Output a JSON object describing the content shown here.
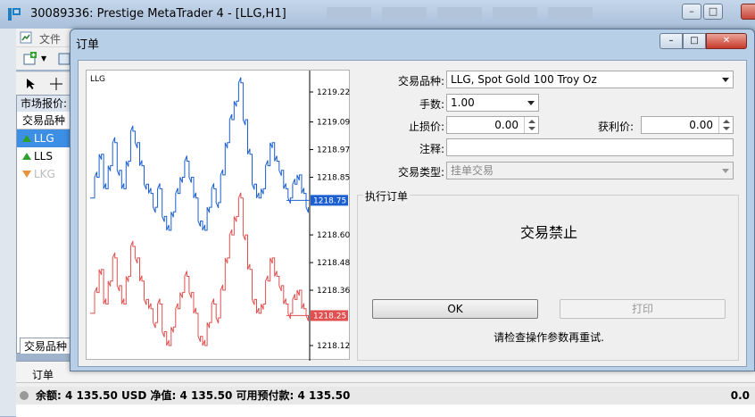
{
  "app": {
    "title": "30089336: Prestige MetaTrader 4 - [LLG,H1]",
    "menu_file": "文件"
  },
  "market_watch": {
    "title": "市场报价:",
    "column_header": "交易品种",
    "symbols": [
      {
        "name": "LLG",
        "direction": "up",
        "selected": true
      },
      {
        "name": "LLS",
        "direction": "up",
        "selected": false
      },
      {
        "name": "LKG",
        "direction": "down",
        "selected": false
      }
    ],
    "bottom_tab": "交易品种"
  },
  "terminal": {
    "tab": "订单",
    "balance_text": "余额: 4 135.50 USD  净值: 4 135.50  可用预付款: 4 135.50",
    "right_value": "0.0"
  },
  "dialog": {
    "title": "订单",
    "symbol_label": "交易品种:",
    "symbol_value": "LLG, Spot Gold 100 Troy Oz",
    "volume_label": "手数:",
    "volume_value": "1.00",
    "sl_label": "止损价:",
    "sl_value": "0.00",
    "tp_label": "获利价:",
    "tp_value": "0.00",
    "comment_label": "注释:",
    "comment_value": "",
    "type_label": "交易类型:",
    "type_value": "挂单交易",
    "group_title": "执行订单",
    "status": "交易禁止",
    "ok_label": "OK",
    "print_label": "打印",
    "hint": "请检查操作参数再重试."
  },
  "chart_data": {
    "type": "line",
    "title": "LLG",
    "y_ticks": [
      "1219.22",
      "1219.09",
      "1218.97",
      "1218.85",
      "1218.60",
      "1218.48",
      "1218.36",
      "1218.12"
    ],
    "ylim": [
      1218.12,
      1219.22
    ],
    "bid_label": "1218.25",
    "ask_label": "1218.75",
    "series": [
      {
        "color": "#1c5fd0",
        "values": [
          1218.76,
          1218.85,
          1218.95,
          1218.8,
          1218.9,
          1219.0,
          1218.88,
          1218.8,
          1218.92,
          1219.05,
          1219.0,
          1218.9,
          1218.82,
          1218.78,
          1218.72,
          1218.8,
          1218.68,
          1218.62,
          1218.7,
          1218.78,
          1218.85,
          1218.92,
          1218.85,
          1218.76,
          1218.66,
          1218.62,
          1218.72,
          1218.8,
          1218.74,
          1218.86,
          1219.0,
          1219.1,
          1219.18,
          1219.26,
          1219.1,
          1218.95,
          1218.82,
          1218.76,
          1218.8,
          1218.9,
          1219.0,
          1218.92,
          1218.88,
          1218.8,
          1218.76,
          1218.82,
          1218.86,
          1218.78,
          1218.72
        ]
      },
      {
        "color": "#e05050",
        "values": [
          1218.26,
          1218.35,
          1218.45,
          1218.3,
          1218.4,
          1218.5,
          1218.38,
          1218.3,
          1218.42,
          1218.55,
          1218.5,
          1218.4,
          1218.32,
          1218.28,
          1218.22,
          1218.3,
          1218.18,
          1218.12,
          1218.2,
          1218.28,
          1218.35,
          1218.42,
          1218.35,
          1218.26,
          1218.16,
          1218.12,
          1218.22,
          1218.3,
          1218.24,
          1218.36,
          1218.5,
          1218.6,
          1218.68,
          1218.76,
          1218.6,
          1218.45,
          1218.32,
          1218.26,
          1218.3,
          1218.4,
          1218.5,
          1218.42,
          1218.38,
          1218.3,
          1218.26,
          1218.32,
          1218.36,
          1218.28,
          1218.25
        ]
      }
    ]
  }
}
